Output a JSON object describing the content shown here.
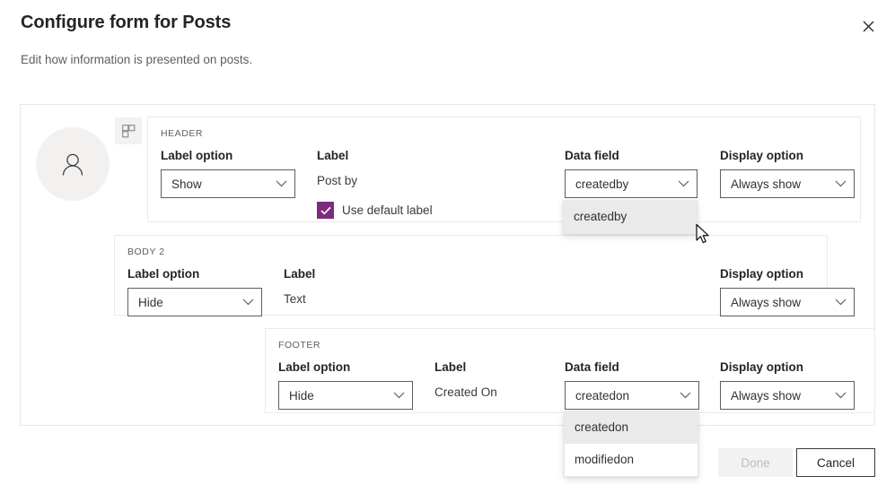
{
  "dialog": {
    "title": "Configure form for Posts",
    "subtitle": "Edit how information is presented on posts.",
    "close_icon": "close-icon"
  },
  "preview": {
    "avatar_icon": "person-icon",
    "layout_icon": "grid-layout-icon"
  },
  "column_headers": {
    "label_option": "Label option",
    "label": "Label",
    "data_field": "Data field",
    "display_option": "Display option"
  },
  "sections": {
    "header": {
      "kicker": "HEADER",
      "label_option_value": "Show",
      "label_value": "Post by",
      "checkbox_label": "Use default label",
      "checkbox_checked": true,
      "data_field_value": "createdby",
      "display_option_value": "Always show",
      "data_field_open": true,
      "data_field_options": [
        "createdby"
      ],
      "data_field_selected": "createdby"
    },
    "body2": {
      "kicker": "BODY 2",
      "label_option_value": "Hide",
      "label_value": "Text",
      "display_option_value": "Always show"
    },
    "footer": {
      "kicker": "FOOTER",
      "label_option_value": "Hide",
      "label_value": "Created On",
      "data_field_value": "createdon",
      "display_option_value": "Always show",
      "data_field_open": true,
      "data_field_options": [
        "createdon",
        "modifiedon"
      ],
      "data_field_selected": "createdon"
    }
  },
  "actions": {
    "done_label": "Done",
    "done_disabled": true,
    "cancel_label": "Cancel"
  },
  "colors": {
    "accent_checkbox": "#7b2d7b",
    "dropdown_highlight": "#ebeaea",
    "border": "#605e5c",
    "muted_text": "#605e5c"
  }
}
